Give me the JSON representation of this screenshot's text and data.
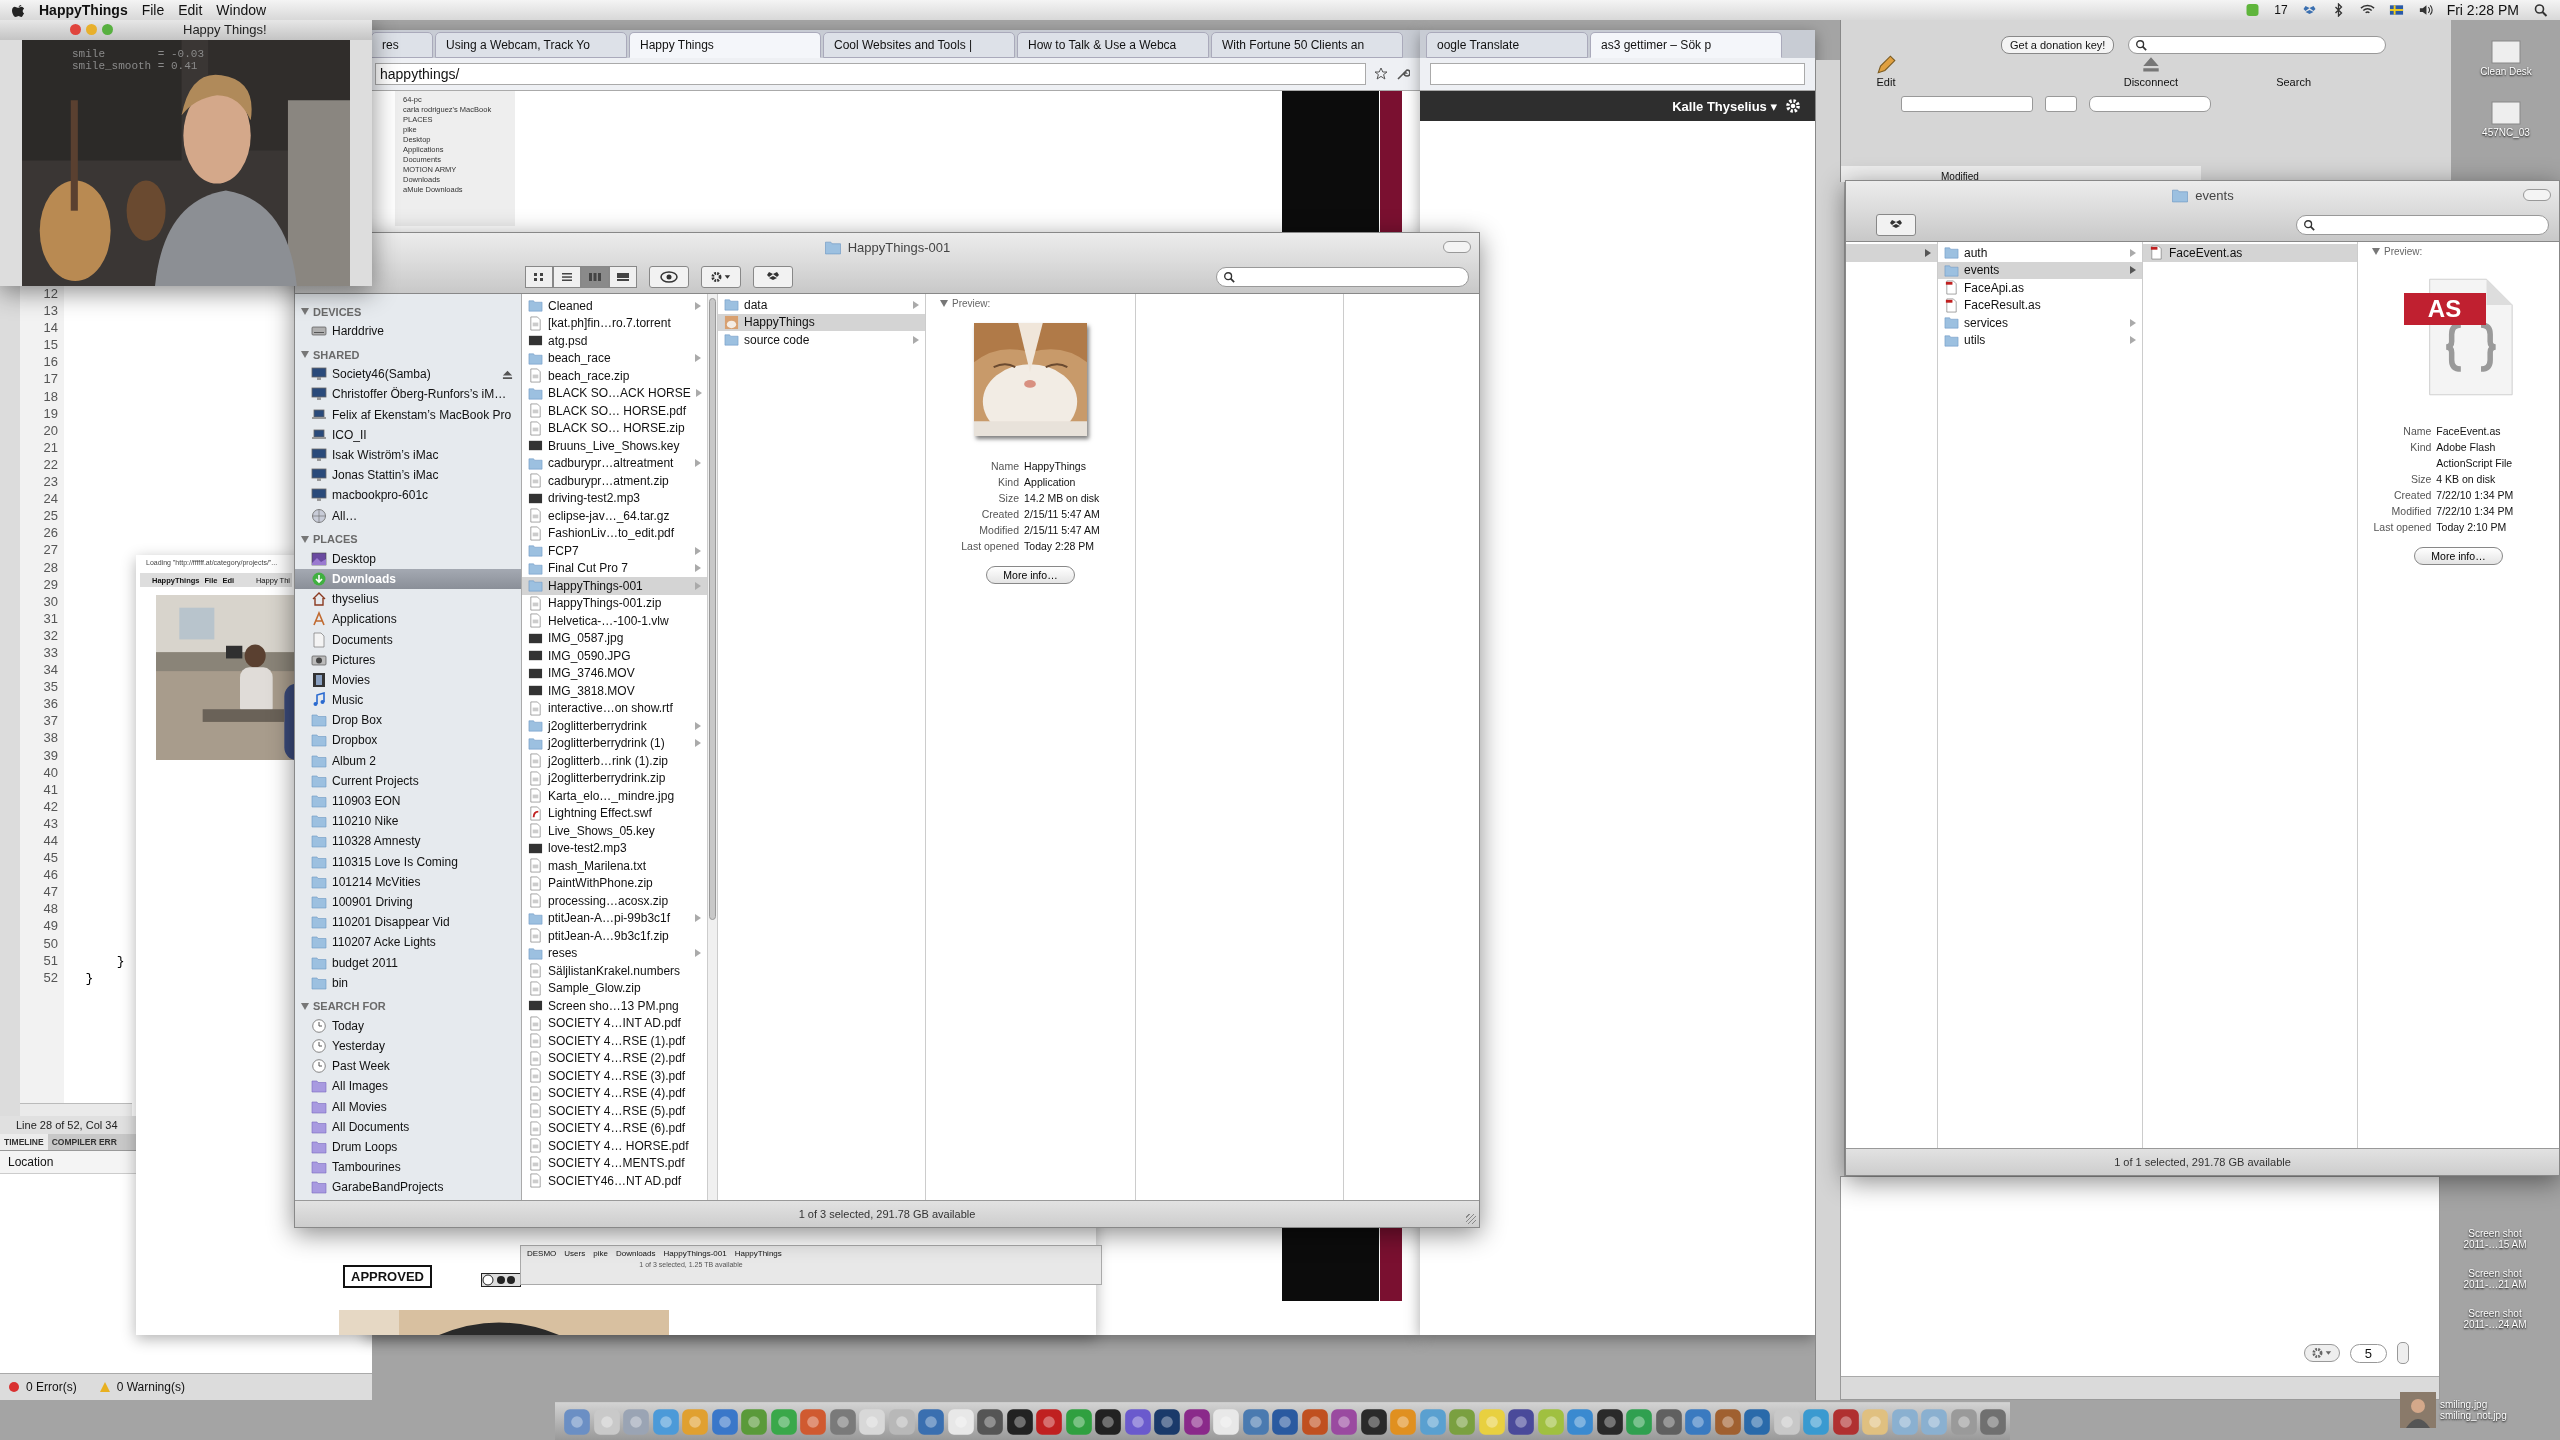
{
  "menu_bar": {
    "app": "HappyThings",
    "menus": [
      "File",
      "Edit",
      "Window"
    ],
    "badge": "17",
    "clock": "Fri 2:28 PM"
  },
  "webcam_window": {
    "title": "Happy Things!",
    "readouts": [
      "smile        = -0.03",
      "smile_smooth = 0.41"
    ]
  },
  "code_editor": {
    "lines": [
      {
        "n": "12"
      },
      {
        "n": "13"
      },
      {
        "n": "14"
      },
      {
        "n": "15"
      },
      {
        "n": "16"
      },
      {
        "n": "17"
      },
      {
        "n": "18"
      },
      {
        "n": "19"
      },
      {
        "n": "20"
      },
      {
        "n": "21"
      },
      {
        "n": "22"
      },
      {
        "n": "23"
      },
      {
        "n": "24"
      },
      {
        "n": "25"
      },
      {
        "n": "26"
      },
      {
        "n": "27"
      },
      {
        "n": "28"
      },
      {
        "n": "29"
      },
      {
        "n": "30"
      },
      {
        "n": "31"
      },
      {
        "n": "32"
      },
      {
        "n": "33"
      },
      {
        "n": "34"
      },
      {
        "n": "35"
      },
      {
        "n": "36"
      },
      {
        "n": "37"
      },
      {
        "n": "38"
      },
      {
        "n": "39"
      },
      {
        "n": "40"
      },
      {
        "n": "41"
      },
      {
        "n": "42"
      },
      {
        "n": "43"
      },
      {
        "n": "44"
      },
      {
        "n": "45"
      },
      {
        "n": "46"
      },
      {
        "n": "47"
      },
      {
        "n": "48"
      },
      {
        "n": "49"
      },
      {
        "n": "50"
      },
      {
        "n": "51",
        "code": "      }"
      },
      {
        "n": "52",
        "code": "  }"
      }
    ],
    "position": "Line 28 of 52, Col 34",
    "panel_tabs": [
      {
        "label": "TIMELINE",
        "selected": true
      },
      {
        "label": "COMPILER ERR",
        "selected": false
      }
    ],
    "location_header": "Location",
    "errors": "0 Error(s)",
    "warnings": "0 Warning(s)"
  },
  "browser": {
    "tabs": [
      {
        "label": "res",
        "selected": false
      },
      {
        "label": "Using a Webcam, Track Yo",
        "selected": false
      },
      {
        "label": "Happy Things",
        "selected": true
      },
      {
        "label": "Cool Websites and Tools |",
        "selected": false
      },
      {
        "label": "How to Talk & Use a Webca",
        "selected": false
      },
      {
        "label": "With Fortune 50 Clients an",
        "selected": false
      }
    ],
    "address": "happythings/",
    "thumbnail_items": [
      "64-pc",
      "carla rodriguez's MacBook",
      "PLACES",
      "pike",
      "Desktop",
      "Applications",
      "Documents",
      "MOTION ARMY",
      "Downloads",
      "aMule Downloads"
    ]
  },
  "browser_2": {
    "tabs": [
      {
        "label": "oogle Translate",
        "selected": false
      },
      {
        "label": "as3 gettimer – Sök p",
        "selected": true
      }
    ],
    "user_menu": "Kalle Thyselius ▾"
  },
  "rear_window": {
    "loading": "Loading \"http://ffffff.at/category/projects/\"...",
    "mini_menu": [
      "HappyThings",
      "File",
      "Edi"
    ],
    "mini_title": "Happy Thi",
    "path": [
      "DESMO",
      "Users",
      "pike",
      "Downloads",
      "HappyThings-001",
      "HappyThings"
    ],
    "status": "1 of 3 selected, 1.25 TB available",
    "badge": "APPROVED"
  },
  "finder": {
    "title": "HappyThings-001",
    "view_modes": [
      {
        "kind": "icons",
        "selected": false
      },
      {
        "kind": "list",
        "selected": false
      },
      {
        "kind": "columns",
        "selected": true
      },
      {
        "kind": "coverflow",
        "selected": false
      }
    ],
    "sidebar": [
      {
        "heading": "DEVICES",
        "items": [
          {
            "label": "Harddrive",
            "kind": "drive",
            "selected": false,
            "eject": false
          }
        ]
      },
      {
        "heading": "SHARED",
        "items": [
          {
            "label": "Society46(Samba)",
            "kind": "computer",
            "selected": false,
            "eject": true
          },
          {
            "label": "Christoffer Öberg-Runfors’s iM…",
            "kind": "computer",
            "selected": false,
            "eject": false
          },
          {
            "label": "Felix af Ekenstam’s MacBook Pro",
            "kind": "laptop",
            "selected": false,
            "eject": false
          },
          {
            "label": "ICO_II",
            "kind": "laptop",
            "selected": false,
            "eject": false
          },
          {
            "label": "Isak Wiström’s iMac",
            "kind": "computer",
            "selected": false,
            "eject": false
          },
          {
            "label": "Jonas Stattin’s iMac",
            "kind": "computer",
            "selected": false,
            "eject": false
          },
          {
            "label": "macbookpro-601c",
            "kind": "computer",
            "selected": false,
            "eject": false
          },
          {
            "label": "All…",
            "kind": "network",
            "selected": false,
            "eject": false
          }
        ]
      },
      {
        "heading": "PLACES",
        "items": [
          {
            "label": "Desktop",
            "kind": "desktop",
            "selected": false,
            "eject": false
          },
          {
            "label": "Downloads",
            "kind": "download",
            "selected": true,
            "eject": false
          },
          {
            "label": "thyselius",
            "kind": "home",
            "selected": false,
            "eject": false
          },
          {
            "label": "Applications",
            "kind": "apps",
            "selected": false,
            "eject": false
          },
          {
            "label": "Documents",
            "kind": "document",
            "selected": false,
            "eject": false
          },
          {
            "label": "Pictures",
            "kind": "camera",
            "selected": false,
            "eject": false
          },
          {
            "label": "Movies",
            "kind": "film",
            "selected": false,
            "eject": false
          },
          {
            "label": "Music",
            "kind": "music",
            "selected": false,
            "eject": false
          },
          {
            "label": "Drop Box",
            "kind": "folder",
            "selected": false,
            "eject": false
          },
          {
            "label": "Dropbox",
            "kind": "folder",
            "selected": false,
            "eject": false
          },
          {
            "label": "Album 2",
            "kind": "folder",
            "selected": false,
            "eject": false
          },
          {
            "label": "Current Projects",
            "kind": "folder",
            "selected": false,
            "eject": false
          },
          {
            "label": "110903 EON",
            "kind": "folder",
            "selected": false,
            "eject": false
          },
          {
            "label": "110210 Nike",
            "kind": "folder",
            "selected": false,
            "eject": false
          },
          {
            "label": "110328 Amnesty",
            "kind": "folder",
            "selected": false,
            "eject": false
          },
          {
            "label": "110315 Love Is Coming",
            "kind": "folder",
            "selected": false,
            "eject": false
          },
          {
            "label": "101214 McVities",
            "kind": "folder",
            "selected": false,
            "eject": false
          },
          {
            "label": "100901 Driving",
            "kind": "folder",
            "selected": false,
            "eject": false
          },
          {
            "label": "110201 Disappear Vid",
            "kind": "folder",
            "selected": false,
            "eject": false
          },
          {
            "label": "110207 Acke Lights",
            "kind": "folder",
            "selected": false,
            "eject": false
          },
          {
            "label": "budget 2011",
            "kind": "folder",
            "selected": false,
            "eject": false
          },
          {
            "label": "bin",
            "kind": "folder",
            "selected": false,
            "eject": false
          }
        ]
      },
      {
        "heading": "SEARCH FOR",
        "items": [
          {
            "label": "Today",
            "kind": "clock",
            "selected": false,
            "eject": false
          },
          {
            "label": "Yesterday",
            "kind": "clock",
            "selected": false,
            "eject": false
          },
          {
            "label": "Past Week",
            "kind": "clock",
            "selected": false,
            "eject": false
          },
          {
            "label": "All Images",
            "kind": "smart",
            "selected": false,
            "eject": false
          },
          {
            "label": "All Movies",
            "kind": "smart",
            "selected": false,
            "eject": false
          },
          {
            "label": "All Documents",
            "kind": "smart",
            "selected": false,
            "eject": false
          },
          {
            "label": "Drum Loops",
            "kind": "smart",
            "selected": false,
            "eject": false
          },
          {
            "label": "Tambourines",
            "kind": "smart",
            "selected": false,
            "eject": false
          },
          {
            "label": "GarabeBandProjects",
            "kind": "smart",
            "selected": false,
            "eject": false
          }
        ]
      }
    ],
    "column_1": [
      {
        "name": "Cleaned",
        "kind": "folder",
        "selected": false
      },
      {
        "name": "[kat.ph]fin…ro.7.torrent",
        "kind": "file",
        "selected": false
      },
      {
        "name": "atg.psd",
        "kind": "media",
        "selected": false
      },
      {
        "name": "beach_race",
        "kind": "folder",
        "selected": false
      },
      {
        "name": "beach_race.zip",
        "kind": "file",
        "selected": false
      },
      {
        "name": "BLACK SO…ACK HORSE",
        "kind": "folder",
        "selected": false
      },
      {
        "name": "BLACK SO… HORSE.pdf",
        "kind": "file",
        "selected": false
      },
      {
        "name": "BLACK SO… HORSE.zip",
        "kind": "file",
        "selected": false
      },
      {
        "name": "Bruuns_Live_Shows.key",
        "kind": "media",
        "selected": false
      },
      {
        "name": "cadburypr…altreatment",
        "kind": "folder",
        "selected": false
      },
      {
        "name": "cadburypr…atment.zip",
        "kind": "file",
        "selected": false
      },
      {
        "name": "driving-test2.mp3",
        "kind": "media",
        "selected": false
      },
      {
        "name": "eclipse-jav…_64.tar.gz",
        "kind": "file",
        "selected": false
      },
      {
        "name": "FashionLiv…to_edit.pdf",
        "kind": "file",
        "selected": false
      },
      {
        "name": "FCP7",
        "kind": "folder",
        "selected": false
      },
      {
        "name": "Final Cut Pro 7",
        "kind": "folder",
        "selected": false
      },
      {
        "name": "HappyThings-001",
        "kind": "folder",
        "selected": true
      },
      {
        "name": "HappyThings-001.zip",
        "kind": "file",
        "selected": false
      },
      {
        "name": "Helvetica-…-100-1.vlw",
        "kind": "file",
        "selected": false
      },
      {
        "name": "IMG_0587.jpg",
        "kind": "media",
        "selected": false
      },
      {
        "name": "IMG_0590.JPG",
        "kind": "media",
        "selected": false
      },
      {
        "name": "IMG_3746.MOV",
        "kind": "media",
        "selected": false
      },
      {
        "name": "IMG_3818.MOV",
        "kind": "media",
        "selected": false
      },
      {
        "name": "interactive…on show.rtf",
        "kind": "file",
        "selected": false
      },
      {
        "name": "j2oglitterberrydrink",
        "kind": "folder",
        "selected": false
      },
      {
        "name": "j2oglitterberrydrink (1)",
        "kind": "folder",
        "selected": false
      },
      {
        "name": "j2oglitterb…rink (1).zip",
        "kind": "file",
        "selected": false
      },
      {
        "name": "j2oglitterberrydrink.zip",
        "kind": "file",
        "selected": false
      },
      {
        "name": "Karta_elo…_mindre.jpg",
        "kind": "file",
        "selected": false
      },
      {
        "name": "Lightning Effect.swf",
        "kind": "flash",
        "selected": false
      },
      {
        "name": "Live_Shows_05.key",
        "kind": "file",
        "selected": false
      },
      {
        "name": "love-test2.mp3",
        "kind": "media",
        "selected": false
      },
      {
        "name": "mash_Marilena.txt",
        "kind": "file",
        "selected": false
      },
      {
        "name": "PaintWithPhone.zip",
        "kind": "file",
        "selected": false
      },
      {
        "name": "processing…acosx.zip",
        "kind": "file",
        "selected": false
      },
      {
        "name": "ptitJean-A…pi-99b3c1f",
        "kind": "folder",
        "selected": false
      },
      {
        "name": "ptitJean-A…9b3c1f.zip",
        "kind": "file",
        "selected": false
      },
      {
        "name": "reses",
        "kind": "folder",
        "selected": false
      },
      {
        "name": "SäljlistanKrakel.numbers",
        "kind": "file",
        "selected": false
      },
      {
        "name": "Sample_Glow.zip",
        "kind": "file",
        "selected": false
      },
      {
        "name": "Screen sho…13 PM.png",
        "kind": "media",
        "selected": false
      },
      {
        "name": "SOCIETY 4…INT AD.pdf",
        "kind": "file",
        "selected": false
      },
      {
        "name": "SOCIETY 4…RSE (1).pdf",
        "kind": "file",
        "selected": false
      },
      {
        "name": "SOCIETY 4…RSE (2).pdf",
        "kind": "file",
        "selected": false
      },
      {
        "name": "SOCIETY 4…RSE (3).pdf",
        "kind": "file",
        "selected": false
      },
      {
        "name": "SOCIETY 4…RSE (4).pdf",
        "kind": "file",
        "selected": false
      },
      {
        "name": "SOCIETY 4…RSE (5).pdf",
        "kind": "file",
        "selected": false
      },
      {
        "name": "SOCIETY 4…RSE (6).pdf",
        "kind": "file",
        "selected": false
      },
      {
        "name": "SOCIETY 4… HORSE.pdf",
        "kind": "file",
        "selected": false
      },
      {
        "name": "SOCIETY 4…MENTS.pdf",
        "kind": "file",
        "selected": false
      },
      {
        "name": "SOCIETY46…NT AD.pdf",
        "kind": "file",
        "selected": false
      }
    ],
    "column_2": [
      {
        "name": "data",
        "kind": "folder",
        "selected": false
      },
      {
        "name": "HappyThings",
        "kind": "app",
        "selected": true
      },
      {
        "name": "source code",
        "kind": "folder",
        "selected": false
      }
    ],
    "preview": {
      "label": "Preview:",
      "kind": "picture",
      "info": [
        {
          "key": "Name",
          "value": "HappyThings"
        },
        {
          "key": "Kind",
          "value": "Application"
        },
        {
          "key": "Size",
          "value": "14.2 MB on disk"
        },
        {
          "key": "Created",
          "value": "2/15/11 5:47 AM"
        },
        {
          "key": "Modified",
          "value": "2/15/11 5:47 AM"
        },
        {
          "key": "Last opened",
          "value": "Today 2:28 PM"
        }
      ],
      "button": "More info…"
    },
    "status": "1 of 3 selected, 291.78 GB available"
  },
  "toolbar_window": {
    "donation_button": "Get a donation key!",
    "edit": "Edit",
    "disconnect": "Disconnect",
    "search_label": "Search",
    "column_header": "Modified"
  },
  "finder_events": {
    "title": "events",
    "column_2": [
      {
        "name": "auth",
        "kind": "folder",
        "selected": false
      },
      {
        "name": "events",
        "kind": "folder",
        "selected": true
      },
      {
        "name": "FaceApi.as",
        "kind": "script",
        "selected": false
      },
      {
        "name": "FaceResult.as",
        "kind": "script",
        "selected": false
      },
      {
        "name": "services",
        "kind": "folder",
        "selected": false
      },
      {
        "name": "utils",
        "kind": "folder",
        "selected": false
      }
    ],
    "column_3": [
      {
        "name": "FaceEvent.as",
        "kind": "script",
        "selected": true
      }
    ],
    "preview": {
      "label": "Preview:",
      "icon_label": "AS",
      "info": [
        {
          "key": "Name",
          "value": "FaceEvent.as"
        },
        {
          "key": "Kind",
          "value": "Adobe Flash ActionScript File"
        },
        {
          "key": "Size",
          "value": "4 KB on disk"
        },
        {
          "key": "Created",
          "value": "7/22/10 1:34 PM"
        },
        {
          "key": "Modified",
          "value": "7/22/10 1:34 PM"
        },
        {
          "key": "Last opened",
          "value": "Today 2:10 PM"
        }
      ],
      "button": "More info…"
    },
    "status": "1 of 1 selected, 291.78 GB available"
  },
  "bottom_window": {
    "stepper_value": "5"
  },
  "desktop_icons_top": [
    "Clean Desk",
    "457NC_03"
  ],
  "desktop_icons_bottom": [
    "Screen shot 2011-…15 AM",
    "Screen shot 2011-…21 AM",
    "Screen shot 2011-…24 AM"
  ],
  "desktop_photos": [
    "smiling.jpg",
    "smiling_not.jpg"
  ]
}
